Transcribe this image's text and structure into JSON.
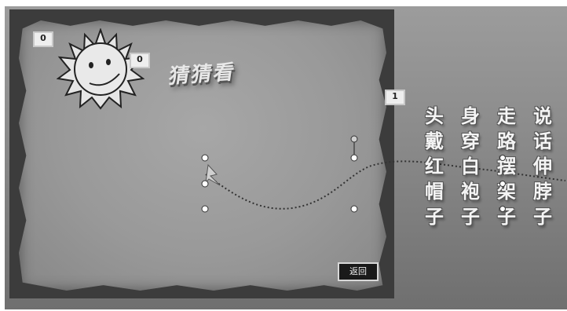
{
  "badges": {
    "top_left": "0",
    "sun": "0",
    "right": "1"
  },
  "title": "猜猜看",
  "characters": [
    [
      "头",
      "身",
      "走",
      "说"
    ],
    [
      "戴",
      "穿",
      "路",
      "话"
    ],
    [
      "红",
      "白",
      "摆",
      "伸"
    ],
    [
      "帽",
      "袍",
      "架",
      "脖"
    ],
    [
      "子",
      "子",
      "子",
      "子"
    ]
  ],
  "back_button": "返回",
  "icons": {
    "sun": "smiling-sun-icon",
    "fox": "fox-icon"
  },
  "colors": {
    "background": "#8a8a8a",
    "paper": "#999999",
    "frame": "#3c3c3c",
    "button": "#1a1a1a"
  }
}
